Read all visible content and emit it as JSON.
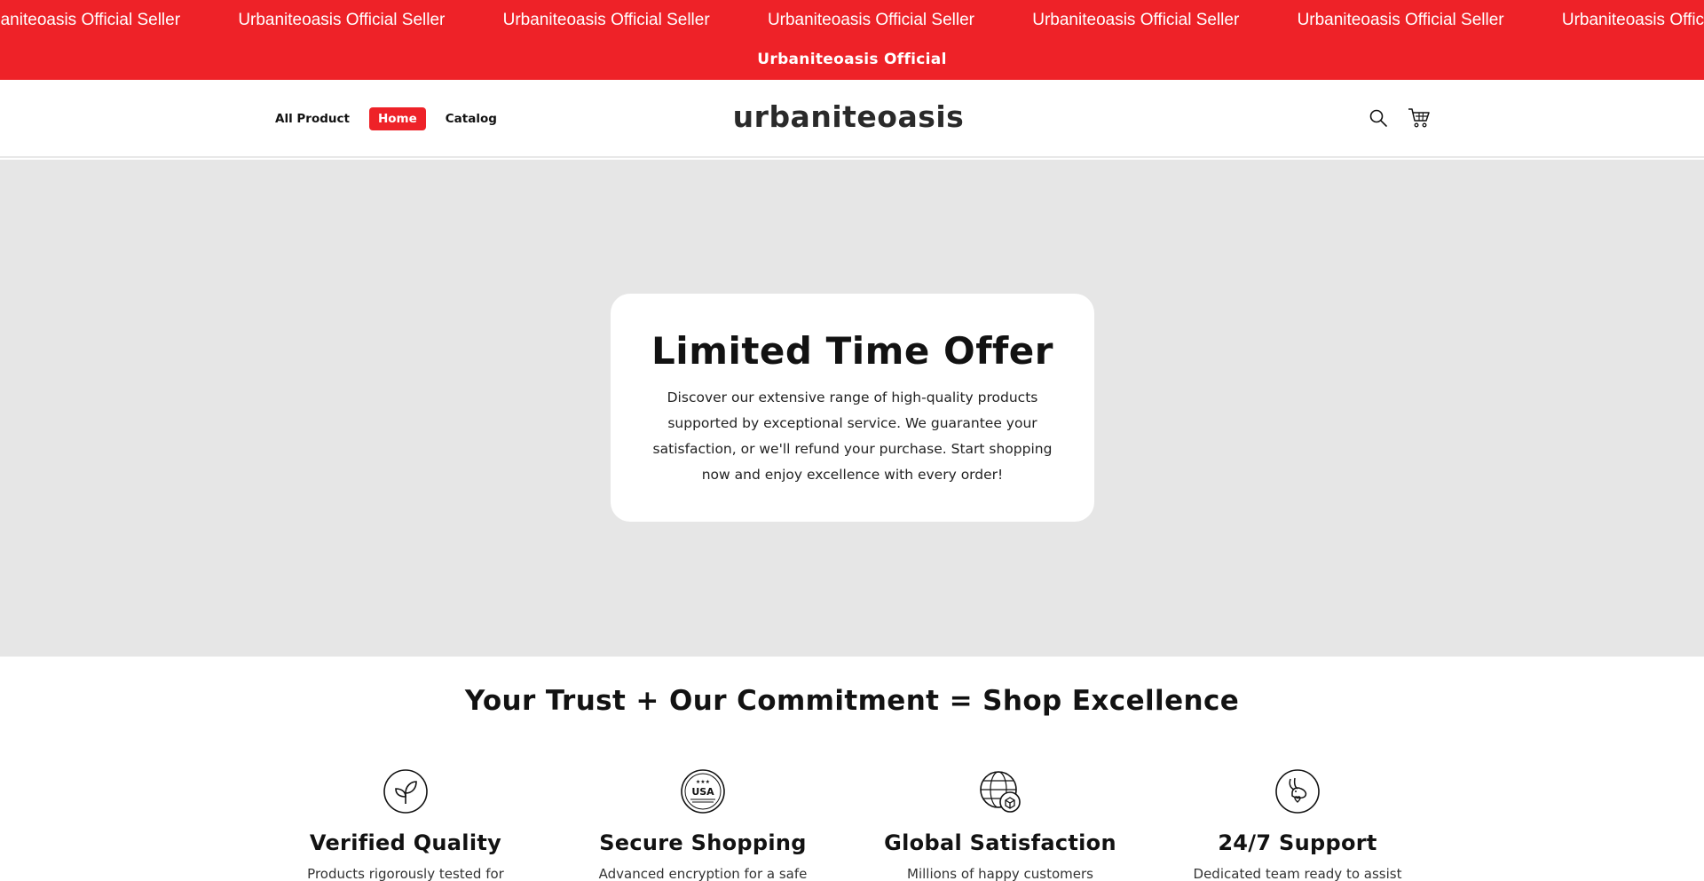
{
  "marquee": {
    "items": [
      "Urbaniteoasis Official Seller",
      "Urbaniteoasis Official Seller",
      "Urbaniteoasis Official Seller",
      "Urbaniteoasis Official Seller",
      "Urbaniteoasis Official Seller",
      "Urbaniteoasis Official Seller",
      "Urbaniteoasis Official Seller"
    ]
  },
  "announcement": "Urbaniteoasis Official",
  "header": {
    "nav": [
      "All Product",
      "Home",
      "Catalog"
    ],
    "active_nav": "Home",
    "logo": "urbaniteoasis",
    "icons": [
      "search-icon",
      "cart-icon"
    ]
  },
  "hero": {
    "title": "Limited Time Offer",
    "text": "Discover our extensive range of high-quality products supported by exceptional service. We guarantee your satisfaction, or we'll refund your purchase. Start shopping now and enjoy excellence with every order!"
  },
  "trust": {
    "title": "Your Trust + Our Commitment = Shop Excellence",
    "features": [
      {
        "icon": "leaf-icon",
        "title": "Verified Quality",
        "text": "Products rigorously tested for"
      },
      {
        "icon": "usa-badge-icon",
        "title": "Secure Shopping",
        "text": "Advanced encryption for a safe"
      },
      {
        "icon": "globe-box-icon",
        "title": "Global Satisfaction",
        "text": "Millions of happy customers"
      },
      {
        "icon": "rabbit-heart-icon",
        "title": "24/7 Support",
        "text": "Dedicated team ready to assist"
      }
    ]
  },
  "colors": {
    "brand_red": "#ee2228",
    "hero_bg": "#e6e6e6",
    "text": "#121212"
  }
}
